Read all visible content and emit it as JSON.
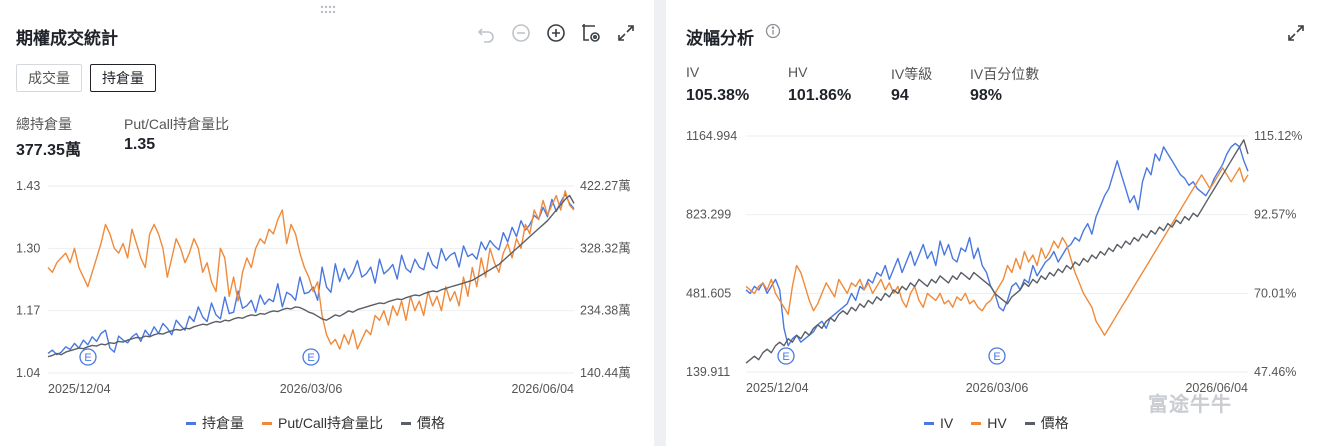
{
  "colors": {
    "blue": "#4a78e0",
    "orange": "#f08a3a",
    "gray": "#5a5f66",
    "grid": "#eceef1",
    "earn": "#4a78e0"
  },
  "options_panel": {
    "title": "期權成交統計",
    "toolbar_icons": [
      "undo-icon",
      "zoom-out-icon",
      "zoom-in-icon",
      "screenshot-settings-icon",
      "fullscreen-icon"
    ],
    "tabs": [
      {
        "label": "成交量",
        "active": false
      },
      {
        "label": "持倉量",
        "active": true
      }
    ],
    "stats": [
      {
        "label": "總持倉量",
        "value": "377.35萬"
      },
      {
        "label": "Put/Call持倉量比",
        "value": "1.35"
      }
    ],
    "legend": [
      {
        "label": "持倉量",
        "color": "#4a78e0"
      },
      {
        "label": "Put/Call持倉量比",
        "color": "#f08a3a"
      },
      {
        "label": "價格",
        "color": "#5a5f66"
      }
    ],
    "earnings_marker": "E"
  },
  "volatility_panel": {
    "title": "波幅分析",
    "info_icon": "info-icon",
    "expand_icon": "fullscreen-icon",
    "stats": [
      {
        "label": "IV",
        "value": "105.38%"
      },
      {
        "label": "HV",
        "value": "101.86%"
      },
      {
        "label": "IV等級",
        "value": "94"
      },
      {
        "label": "IV百分位數",
        "value": "98%"
      }
    ],
    "legend": [
      {
        "label": "IV",
        "color": "#4a78e0"
      },
      {
        "label": "HV",
        "color": "#f08a3a"
      },
      {
        "label": "價格",
        "color": "#5a5f66"
      }
    ],
    "earnings_marker": "E"
  },
  "watermark": "富途牛牛",
  "chart_data": [
    {
      "type": "line",
      "x_ticks": [
        "2025/12/04",
        "2026/03/06",
        "2026/06/04"
      ],
      "y_left": {
        "ticks": [
          "1.43",
          "1.30",
          "1.17",
          "1.04"
        ],
        "range": [
          1.04,
          1.43
        ]
      },
      "y_right": {
        "ticks": [
          "422.27萬",
          "328.32萬",
          "234.38萬",
          "140.44萬"
        ],
        "range": [
          140.44,
          422.27
        ]
      },
      "n_points": 120,
      "earnings_at": [
        17,
        118
      ],
      "series": [
        {
          "name": "持倉量",
          "axis": "right",
          "values": [
            170,
            175,
            168,
            172,
            180,
            176,
            185,
            178,
            190,
            183,
            195,
            188,
            200,
            205,
            178,
            172,
            196,
            190,
            186,
            195,
            200,
            188,
            205,
            196,
            210,
            200,
            215,
            208,
            198,
            220,
            212,
            205,
            226,
            218,
            240,
            225,
            218,
            246,
            228,
            222,
            255,
            230,
            232,
            264,
            238,
            242,
            250,
            232,
            258,
            244,
            252,
            248,
            275,
            240,
            262,
            258,
            250,
            285,
            260,
            262,
            270,
            250,
            300,
            270,
            262,
            305,
            278,
            298,
            282,
            292,
            310,
            285,
            290,
            300,
            276,
            312,
            290,
            296,
            304,
            282,
            318,
            298,
            292,
            312,
            300,
            296,
            322,
            304,
            298,
            328,
            310,
            318,
            322,
            300,
            332,
            316,
            320,
            312,
            338,
            326,
            340,
            332,
            326,
            352,
            338,
            360,
            346,
            370,
            356,
            364,
            378,
            372,
            390,
            376,
            402,
            384,
            398,
            410,
            396,
            388
          ]
        },
        {
          "name": "Put/Call持倉量比",
          "axis": "left",
          "values": [
            1.26,
            1.25,
            1.27,
            1.28,
            1.29,
            1.27,
            1.3,
            1.26,
            1.24,
            1.22,
            1.25,
            1.28,
            1.31,
            1.35,
            1.33,
            1.3,
            1.29,
            1.31,
            1.28,
            1.34,
            1.31,
            1.28,
            1.26,
            1.33,
            1.35,
            1.33,
            1.3,
            1.24,
            1.28,
            1.32,
            1.3,
            1.27,
            1.29,
            1.32,
            1.3,
            1.25,
            1.27,
            1.23,
            1.21,
            1.3,
            1.28,
            1.2,
            1.24,
            1.19,
            1.25,
            1.28,
            1.26,
            1.3,
            1.32,
            1.31,
            1.34,
            1.33,
            1.36,
            1.38,
            1.31,
            1.35,
            1.33,
            1.29,
            1.26,
            1.24,
            1.21,
            1.23,
            1.16,
            1.12,
            1.1,
            1.11,
            1.09,
            1.12,
            1.1,
            1.13,
            1.09,
            1.11,
            1.13,
            1.12,
            1.16,
            1.15,
            1.17,
            1.14,
            1.18,
            1.16,
            1.19,
            1.15,
            1.2,
            1.17,
            1.19,
            1.16,
            1.21,
            1.18,
            1.2,
            1.17,
            1.22,
            1.19,
            1.21,
            1.18,
            1.24,
            1.2,
            1.26,
            1.22,
            1.28,
            1.24,
            1.3,
            1.27,
            1.25,
            1.29,
            1.31,
            1.28,
            1.32,
            1.3,
            1.35,
            1.33,
            1.38,
            1.36,
            1.4,
            1.37,
            1.39,
            1.41,
            1.38,
            1.42,
            1.39,
            1.38
          ]
        },
        {
          "name": "價格",
          "axis": "right",
          "values": [
            165,
            167,
            170,
            168,
            172,
            174,
            176,
            178,
            177,
            180,
            182,
            181,
            184,
            183,
            186,
            185,
            188,
            187,
            190,
            192,
            194,
            193,
            196,
            195,
            198,
            200,
            199,
            202,
            204,
            206,
            205,
            208,
            207,
            210,
            212,
            214,
            213,
            216,
            218,
            217,
            220,
            219,
            222,
            224,
            223,
            226,
            228,
            227,
            230,
            229,
            232,
            234,
            233,
            236,
            238,
            237,
            240,
            239,
            236,
            232,
            230,
            226,
            222,
            220,
            224,
            228,
            226,
            230,
            234,
            232,
            236,
            238,
            240,
            242,
            244,
            246,
            245,
            248,
            250,
            252,
            251,
            254,
            256,
            258,
            257,
            260,
            262,
            264,
            263,
            266,
            268,
            270,
            272,
            274,
            276,
            278,
            280,
            284,
            288,
            292,
            296,
            300,
            304,
            310,
            316,
            322,
            328,
            334,
            340,
            346,
            352,
            358,
            364,
            370,
            378,
            386,
            394,
            402,
            408,
            396
          ]
        }
      ]
    },
    {
      "type": "line",
      "x_ticks": [
        "2025/12/04",
        "2026/03/06",
        "2026/06/04"
      ],
      "y_left": {
        "ticks": [
          "1164.994",
          "823.299",
          "481.605",
          "139.911"
        ],
        "range": [
          139.911,
          1164.994
        ]
      },
      "y_right": {
        "ticks": [
          "115.12%",
          "92.57%",
          "70.01%",
          "47.46%"
        ],
        "range": [
          47.46,
          115.12
        ]
      },
      "n_points": 120,
      "earnings_at": [
        17,
        118
      ],
      "series": [
        {
          "name": "IV",
          "axis": "right",
          "values": [
            71,
            70,
            72,
            71,
            73,
            70,
            72,
            74,
            71,
            60,
            55,
            57,
            58,
            56,
            57,
            58,
            59,
            61,
            62,
            60,
            63,
            64,
            65,
            66,
            67,
            70,
            68,
            72,
            71,
            74,
            73,
            76,
            75,
            78,
            74,
            77,
            80,
            76,
            79,
            82,
            78,
            81,
            84,
            80,
            82,
            78,
            85,
            81,
            84,
            80,
            79,
            83,
            82,
            86,
            80,
            83,
            78,
            76,
            72,
            70,
            66,
            65,
            68,
            72,
            73,
            71,
            74,
            73,
            78,
            75,
            77,
            79,
            80,
            82,
            79,
            81,
            83,
            84,
            86,
            85,
            88,
            90,
            87,
            92,
            95,
            98,
            100,
            104,
            108,
            104,
            100,
            96,
            98,
            94,
            102,
            106,
            104,
            110,
            108,
            112,
            110,
            108,
            106,
            104,
            103,
            101,
            102,
            100,
            99,
            98,
            100,
            103,
            105,
            107,
            110,
            112,
            113,
            112,
            108,
            105
          ]
        },
        {
          "name": "HV",
          "axis": "right",
          "values": [
            72,
            71,
            70,
            72,
            73,
            71,
            74,
            70,
            68,
            66,
            64,
            72,
            78,
            76,
            72,
            68,
            65,
            67,
            70,
            73,
            71,
            69,
            74,
            72,
            70,
            73,
            72,
            74,
            71,
            73,
            70,
            72,
            74,
            71,
            73,
            70,
            72,
            68,
            66,
            70,
            72,
            68,
            66,
            70,
            69,
            68,
            70,
            67,
            68,
            66,
            69,
            68,
            70,
            67,
            68,
            66,
            65,
            67,
            68,
            70,
            72,
            74,
            78,
            76,
            80,
            77,
            82,
            79,
            81,
            78,
            83,
            80,
            82,
            85,
            83,
            86,
            84,
            80,
            76,
            73,
            70,
            68,
            66,
            62,
            60,
            58,
            60,
            62,
            64,
            66,
            68,
            70,
            72,
            74,
            76,
            78,
            80,
            82,
            84,
            86,
            88,
            90,
            92,
            94,
            96,
            98,
            100,
            102,
            104,
            102,
            100,
            102,
            104,
            106,
            104,
            102,
            104,
            106,
            102,
            104
          ]
        },
        {
          "name": "價格",
          "axis": "right",
          "values": [
            50,
            51,
            52,
            51,
            53,
            54,
            53,
            55,
            56,
            55,
            57,
            56,
            58,
            57,
            59,
            58,
            60,
            61,
            60,
            62,
            63,
            62,
            64,
            65,
            64,
            66,
            65,
            67,
            66,
            68,
            67,
            69,
            68,
            70,
            69,
            71,
            70,
            72,
            71,
            73,
            72,
            74,
            73,
            72,
            74,
            73,
            75,
            74,
            73,
            75,
            74,
            76,
            75,
            74,
            76,
            75,
            74,
            73,
            72,
            70,
            69,
            68,
            67,
            69,
            70,
            71,
            73,
            72,
            74,
            73,
            75,
            74,
            76,
            75,
            77,
            76,
            78,
            77,
            79,
            78,
            80,
            79,
            81,
            80,
            82,
            81,
            83,
            82,
            84,
            83,
            85,
            84,
            86,
            85,
            87,
            86,
            88,
            87,
            89,
            88,
            90,
            89,
            91,
            90,
            92,
            91,
            93,
            92,
            94,
            96,
            98,
            100,
            102,
            104,
            106,
            108,
            110,
            112,
            114,
            110
          ]
        }
      ]
    }
  ]
}
